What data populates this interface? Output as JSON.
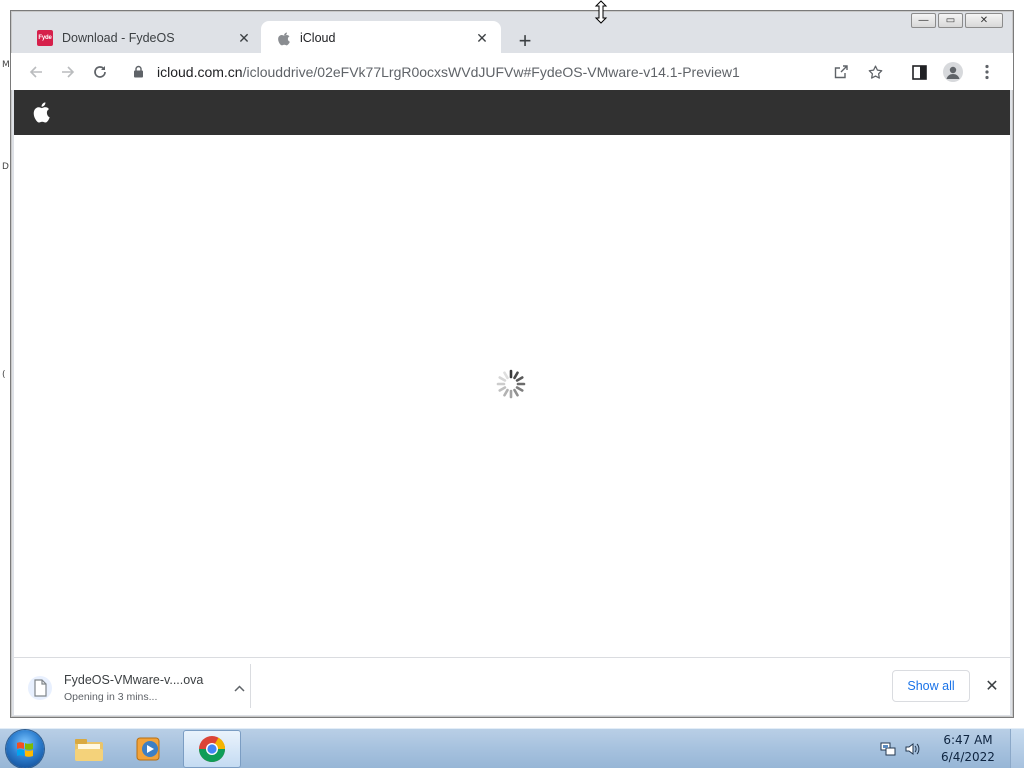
{
  "desktop": {
    "edge_marks": [
      "M",
      "D",
      "("
    ]
  },
  "window": {
    "caption": {
      "minimize": "—",
      "maximize": "▭",
      "close": "✕"
    }
  },
  "tabs": [
    {
      "title": "Download - FydeOS",
      "favicon_text": "Fyde",
      "active": false
    },
    {
      "title": "iCloud",
      "active": true
    }
  ],
  "toolbar": {
    "url_host": "icloud.com.cn",
    "url_path": "/iclouddrive/02eFVk77LrgR0ocxsWVdJUFVw#FydeOS-VMware-v14.1-Preview1"
  },
  "download": {
    "filename": "FydeOS-VMware-v....ova",
    "status": "Opening in 3 mins...",
    "show_all": "Show all"
  },
  "taskbar": {
    "time": "6:47 AM",
    "date": "6/4/2022"
  },
  "icons": {
    "back": "arrow-left-icon",
    "forward": "arrow-right-icon",
    "reload": "reload-icon",
    "lock": "lock-icon",
    "share": "share-icon",
    "bookmark": "star-icon",
    "side_panel": "side-panel-icon",
    "profile": "profile-icon",
    "menu": "kebab-menu-icon"
  },
  "colors": {
    "apple_header": "#313131",
    "tab_strip": "#dee1e6",
    "link_blue": "#1a73e8",
    "fydeos_brand": "#d6204b"
  }
}
